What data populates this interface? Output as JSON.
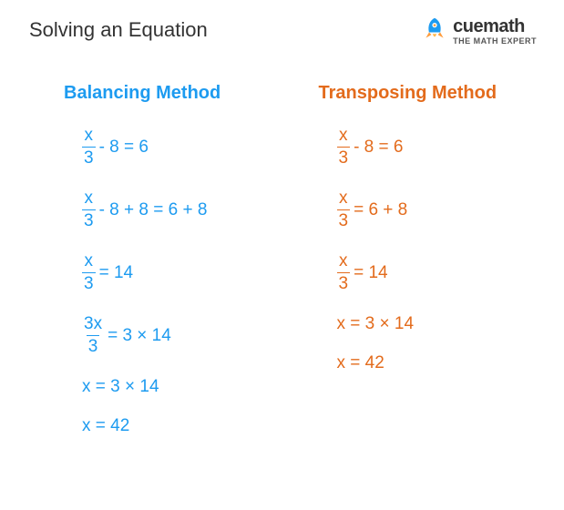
{
  "title": "Solving an Equation",
  "logo": {
    "name": "cuemath",
    "tagline": "THE MATH EXPERT"
  },
  "columns": {
    "balancing": {
      "header": "Balancing Method",
      "steps": [
        {
          "frac": {
            "num": "x",
            "den": "3"
          },
          "suffix": " - 8 = 6"
        },
        {
          "frac": {
            "num": "x",
            "den": "3"
          },
          "suffix": " - 8 + 8 = 6 + 8"
        },
        {
          "frac": {
            "num": "x",
            "den": "3"
          },
          "suffix": " = 14"
        },
        {
          "frac": {
            "num": "3x",
            "den": "3"
          },
          "suffix": " = 3 × 14"
        },
        {
          "plain": "x = 3 × 14"
        },
        {
          "plain": "x = 42"
        }
      ]
    },
    "transposing": {
      "header": "Transposing Method",
      "steps": [
        {
          "frac": {
            "num": "x",
            "den": "3"
          },
          "suffix": " - 8 = 6"
        },
        {
          "frac": {
            "num": "x",
            "den": "3"
          },
          "suffix": " = 6 + 8"
        },
        {
          "frac": {
            "num": "x",
            "den": "3"
          },
          "suffix": " = 14"
        },
        {
          "plain": "x = 3 × 14"
        },
        {
          "plain": "x = 42"
        }
      ]
    }
  }
}
